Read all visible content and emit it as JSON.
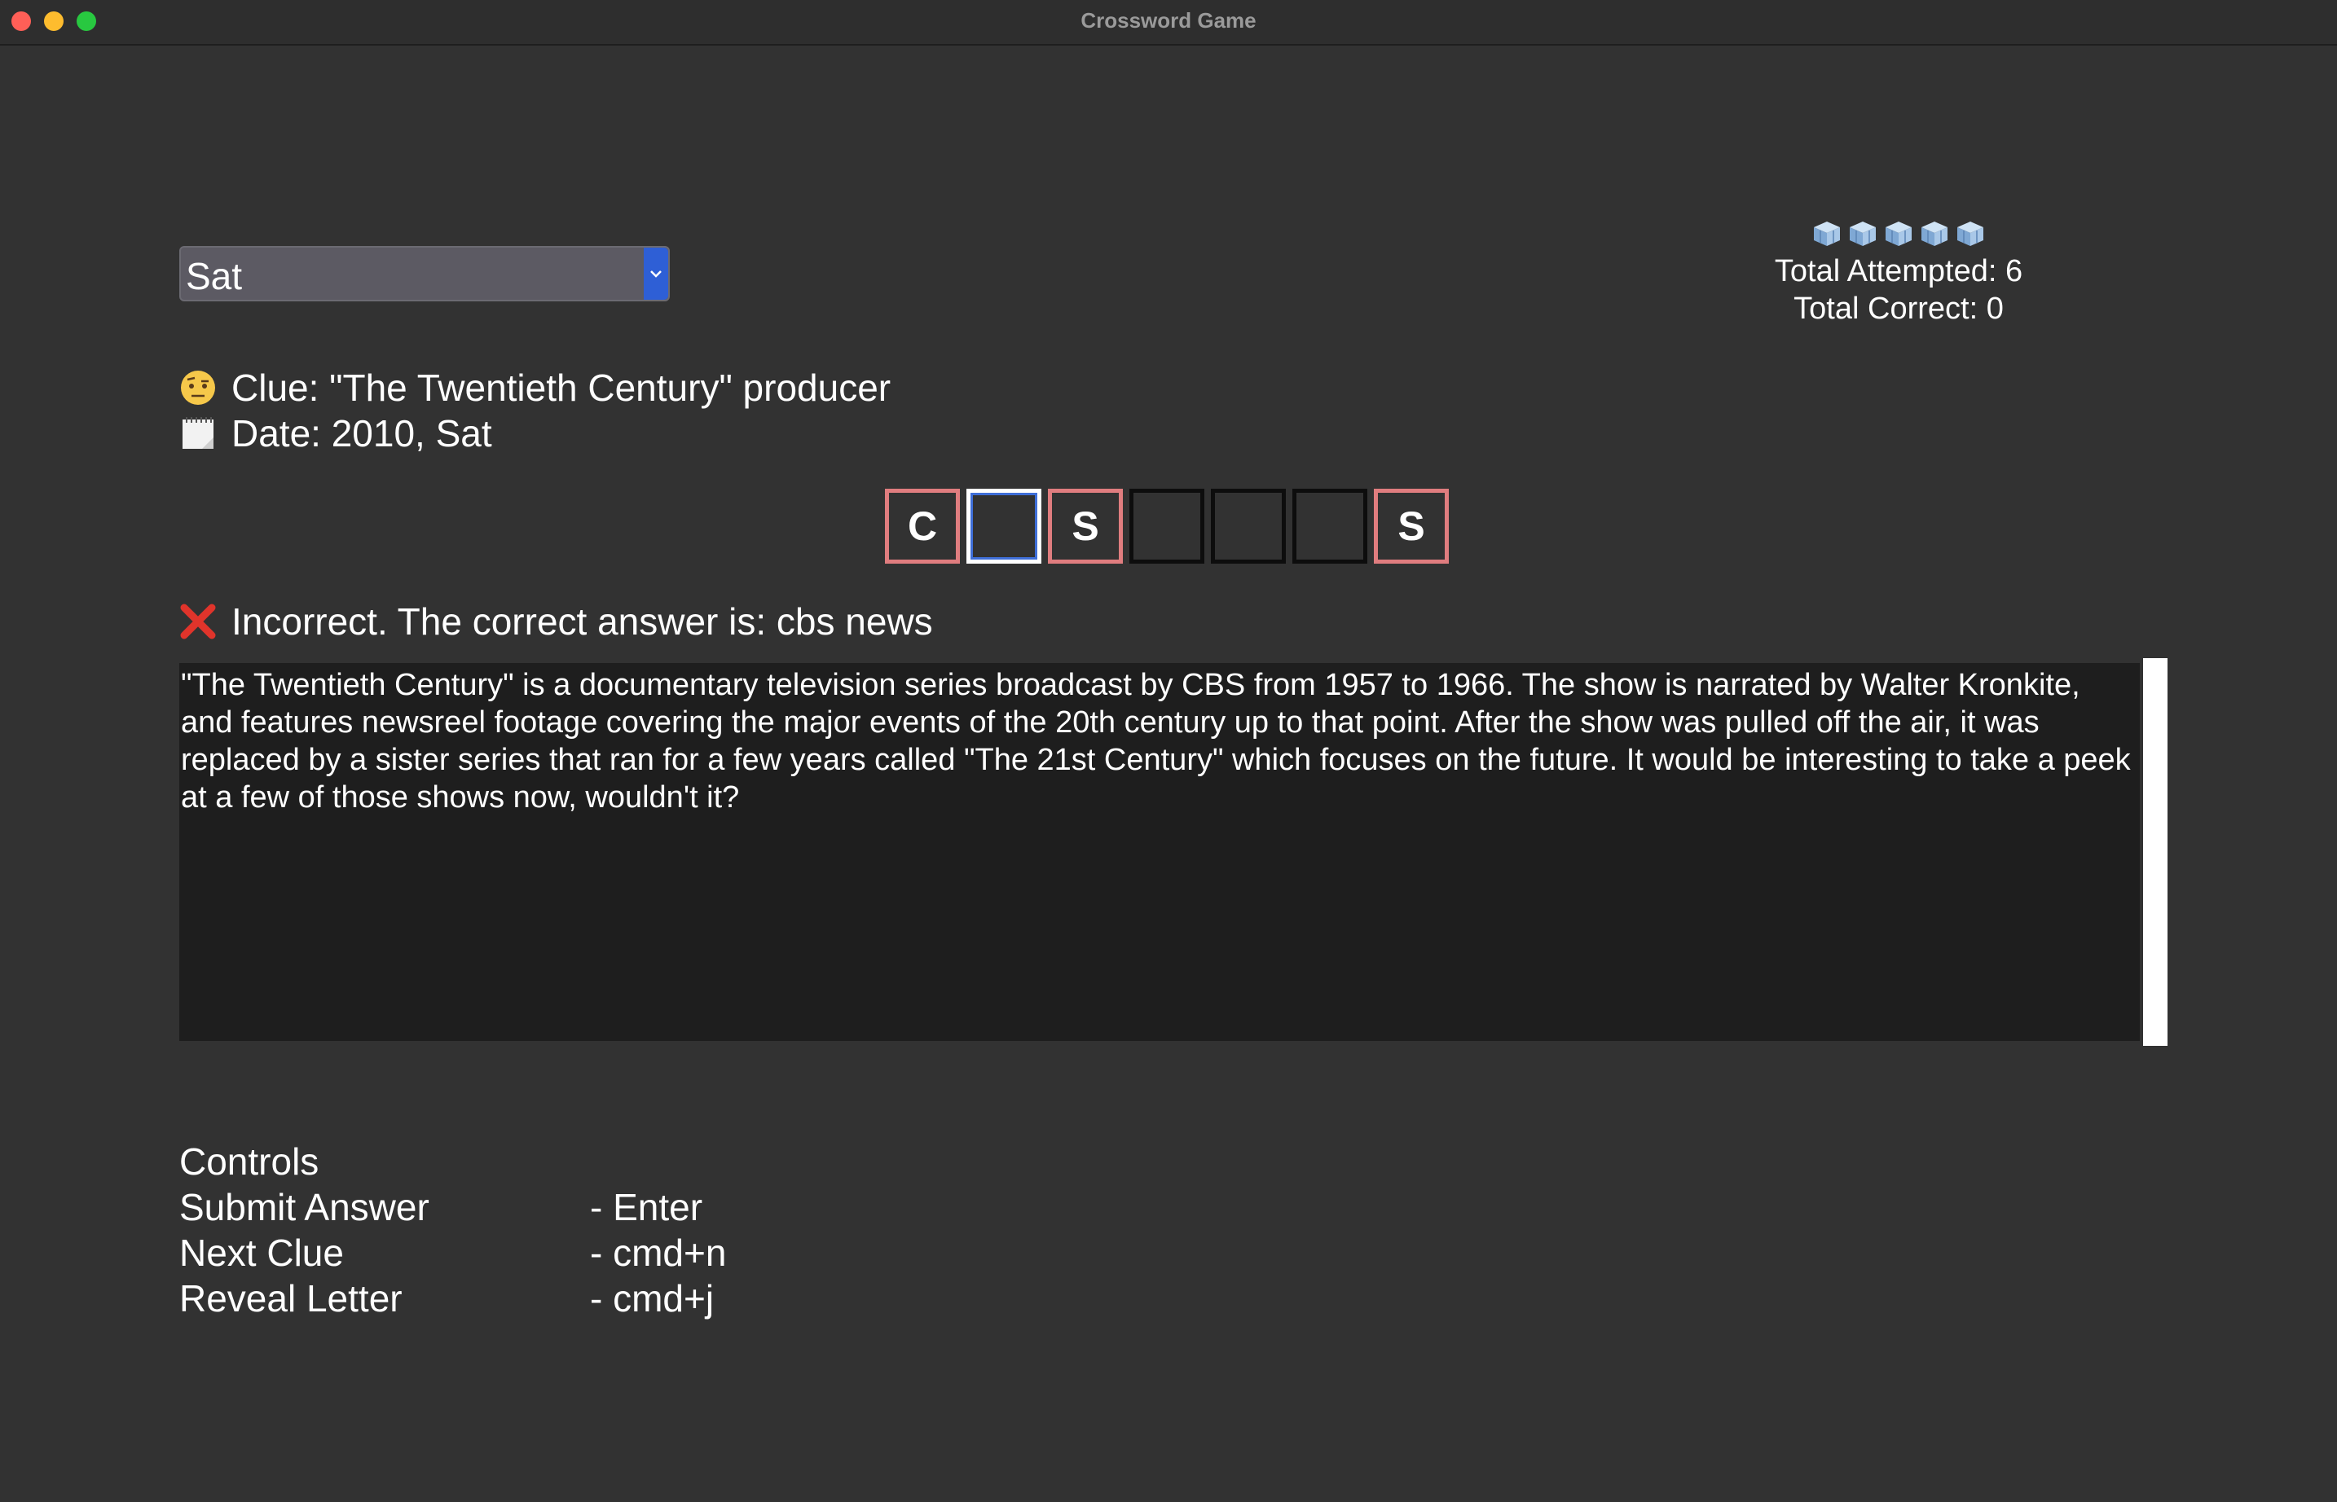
{
  "window": {
    "title": "Crossword Game"
  },
  "day_select": {
    "value": "Sat"
  },
  "stats": {
    "icon": "cube-icon",
    "icon_count": 5,
    "attempted": "Total Attempted: 6",
    "correct": "Total Correct: 0"
  },
  "clue": {
    "icon": "raised-eyebrow-emoji-icon",
    "text": "Clue: \"The Twentieth Century\" producer"
  },
  "date": {
    "icon": "spiral-notepad-icon",
    "text": "Date: 2010, Sat"
  },
  "answer_boxes": [
    {
      "letter": "C",
      "state": "wrong"
    },
    {
      "letter": "",
      "state": "active"
    },
    {
      "letter": "S",
      "state": "wrong"
    },
    {
      "letter": "",
      "state": "empty"
    },
    {
      "letter": "",
      "state": "empty"
    },
    {
      "letter": "",
      "state": "empty"
    },
    {
      "letter": "S",
      "state": "wrong"
    }
  ],
  "result": {
    "icon": "cross-mark-icon",
    "text": "Incorrect. The correct answer is: cbs news"
  },
  "explanation": "\"The Twentieth Century\" is a documentary television series broadcast by CBS from 1957 to 1966. The show is narrated by Walter Kronkite, and features newsreel footage covering the major events of the 20th century up to that point. After the show was pulled off the air, it was replaced by a sister series that ran for a few years called \"The 21st Century\" which focuses on the future. It would be interesting to take a peek at a few of those shows now, wouldn't it?",
  "controls": {
    "heading": "Controls",
    "items": [
      {
        "label": "Submit Answer",
        "key": "- Enter"
      },
      {
        "label": "Next Clue",
        "key": "- cmd+n"
      },
      {
        "label": "Reveal Letter",
        "key": "- cmd+j"
      }
    ]
  },
  "colors": {
    "background": "#323232",
    "wrong_border": "#e07d7f",
    "accent": "#2e5fd6",
    "text_area": "#1e1e1e"
  }
}
